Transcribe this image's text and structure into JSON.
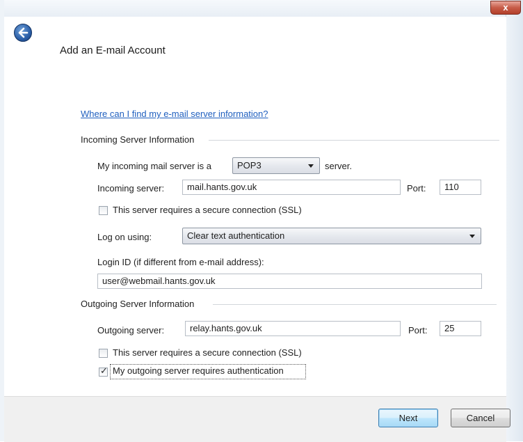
{
  "window": {
    "close_glyph": "x",
    "title": "Add an E-mail Account",
    "back_icon": "back-arrow-icon"
  },
  "help_link": "Where can I find my e-mail server information?",
  "incoming": {
    "group_label": "Incoming Server Information",
    "server_type_prefix": "My incoming mail server is a",
    "server_type_value": "POP3",
    "server_type_suffix": "server.",
    "server_label": "Incoming server:",
    "server_value": "mail.hants.gov.uk",
    "port_label": "Port:",
    "port_value": "110",
    "ssl_label": "This server requires a secure connection (SSL)",
    "ssl_checked": false,
    "logon_label": "Log on using:",
    "logon_value": "Clear text authentication",
    "login_id_label": "Login ID (if different from e-mail address):",
    "login_id_value": "user@webmail.hants.gov.uk"
  },
  "outgoing": {
    "group_label": "Outgoing Server Information",
    "server_label": "Outgoing server:",
    "server_value": "relay.hants.gov.uk",
    "port_label": "Port:",
    "port_value": "25",
    "ssl_label": "This server requires a secure connection (SSL)",
    "ssl_checked": false,
    "auth_label": "My outgoing server requires authentication",
    "auth_checked": true
  },
  "buttons": {
    "next": "Next",
    "cancel": "Cancel"
  },
  "colors": {
    "link": "#1f5fbf",
    "close_button": "#c75c48",
    "footer": "#f0f0f0"
  }
}
